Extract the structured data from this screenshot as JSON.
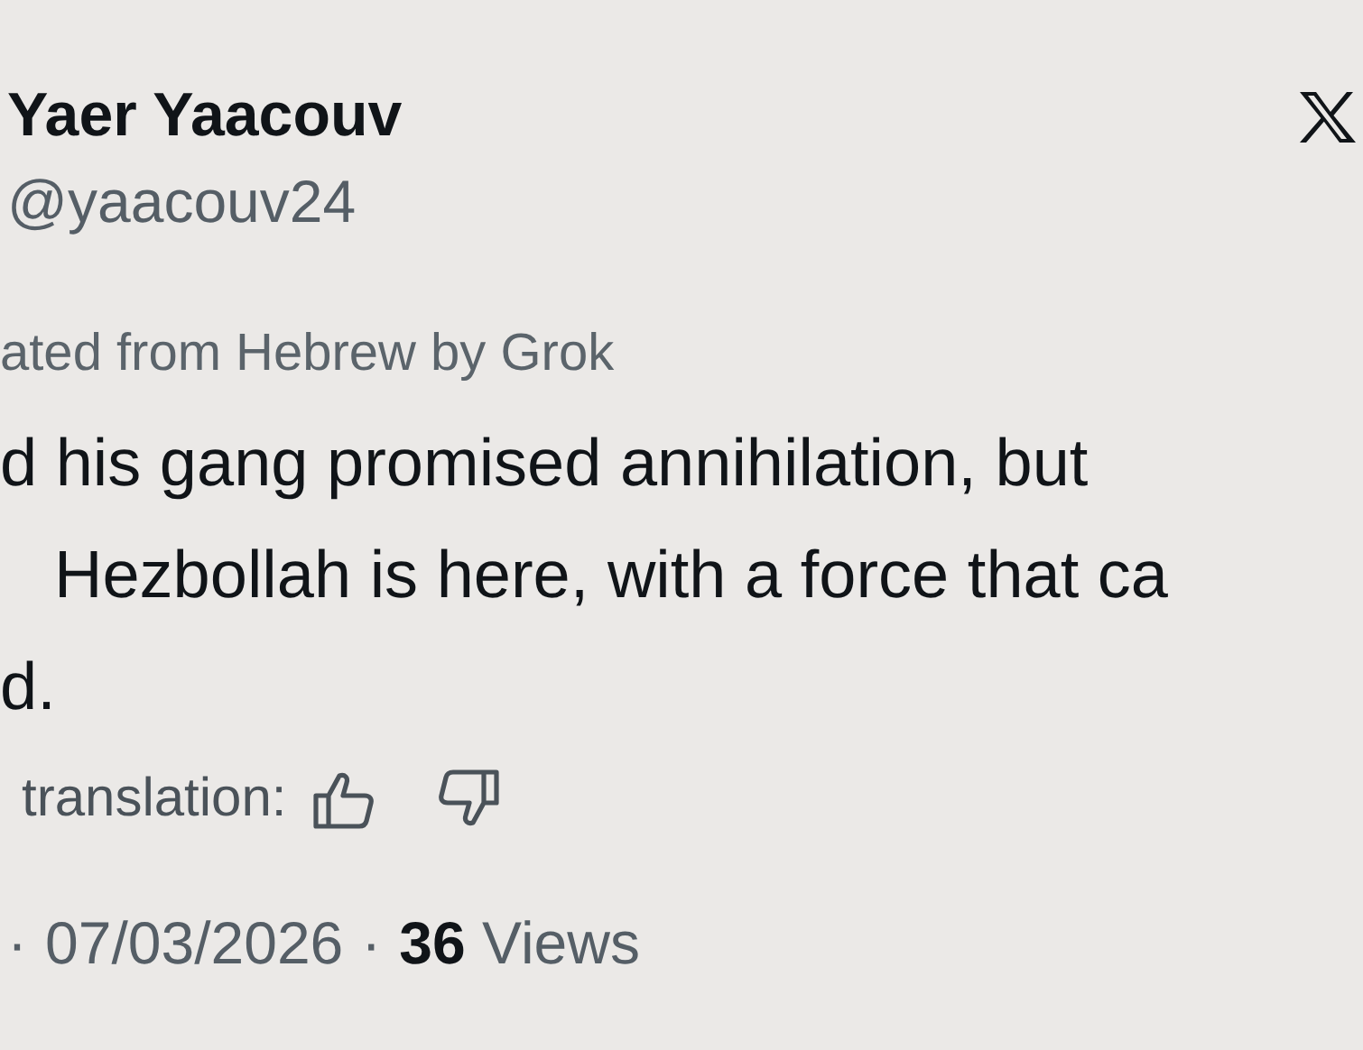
{
  "author": {
    "name": "Yaer Yaacouv",
    "handle": "@yaacouv24"
  },
  "translation_note": "ated from Hebrew by Grok",
  "body_lines": [
    "d his gang promised annihilation, but",
    "Hezbollah is here, with a force that ca",
    "d."
  ],
  "rate_translation": {
    "label": "translation:"
  },
  "meta": {
    "separator_1": "·",
    "date": "07/03/2026",
    "separator_2": "·",
    "views": "**36** Views"
  }
}
